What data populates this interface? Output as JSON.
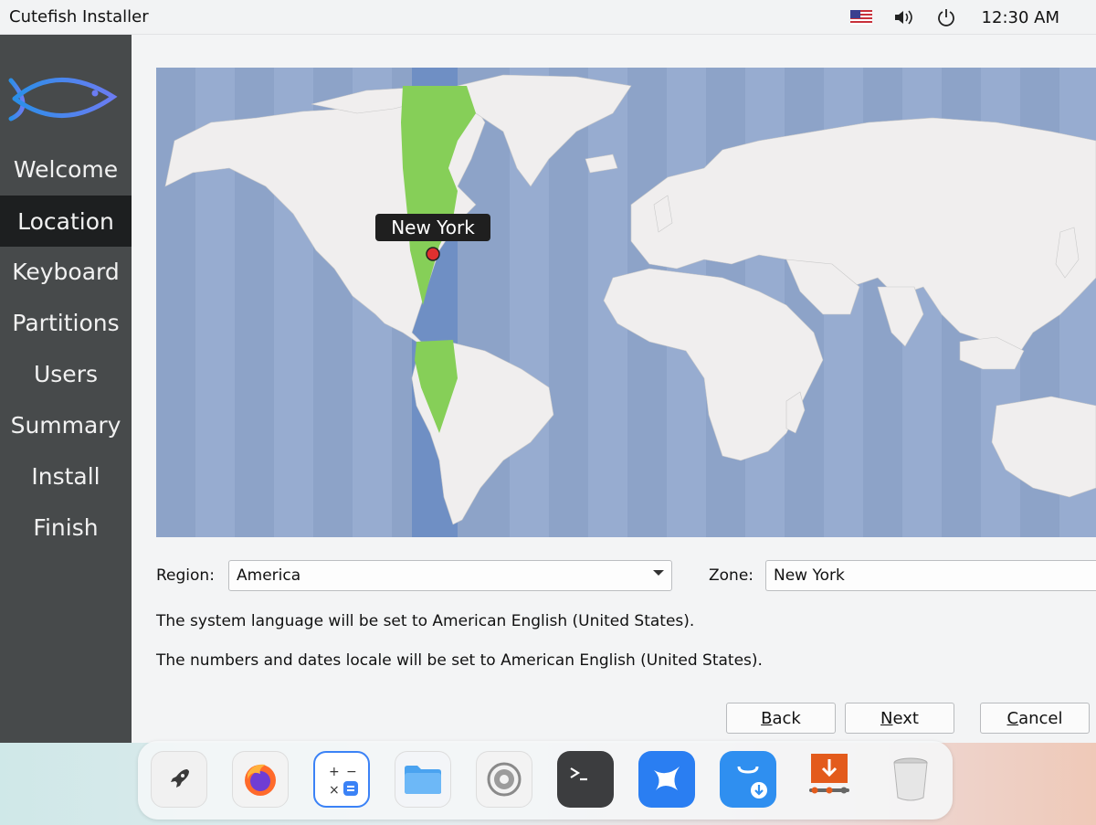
{
  "window": {
    "title": "Cutefish Installer"
  },
  "tray": {
    "time": "12:30 AM",
    "icons": [
      "us-flag-icon",
      "volume-icon",
      "power-icon"
    ]
  },
  "sidebar": {
    "logo": "fish-logo-icon",
    "active_index": 1,
    "items": [
      {
        "label": "Welcome"
      },
      {
        "label": "Location"
      },
      {
        "label": "Keyboard"
      },
      {
        "label": "Partitions"
      },
      {
        "label": "Users"
      },
      {
        "label": "Summary"
      },
      {
        "label": "Install"
      },
      {
        "label": "Finish"
      }
    ]
  },
  "map": {
    "pin_label": "New York"
  },
  "region": {
    "label": "Region:",
    "value": "America"
  },
  "zone": {
    "label": "Zone:",
    "value": "New York"
  },
  "info": {
    "language": "The system language will be set to American English (United States).",
    "locale": "The numbers and dates locale will be set to American English (United States)."
  },
  "buttons": {
    "back": {
      "mnemonic": "B",
      "rest": "ack"
    },
    "next": {
      "mnemonic": "N",
      "rest": "ext"
    },
    "cancel": {
      "mnemonic": "C",
      "rest": "ancel"
    }
  },
  "dock": {
    "apps": [
      "launcher-rocket-icon",
      "firefox-icon",
      "calculator-icon",
      "files-folder-icon",
      "settings-gear-icon",
      "terminal-icon",
      "browser-swift-icon",
      "store-download-icon",
      "installer-download-icon",
      "trash-icon"
    ]
  },
  "colors": {
    "sidebar": "#474a4b",
    "sidebar_active": "#1d1f20",
    "ocean": "#8da3c8",
    "land": "#f0eeee",
    "timezone_highlight": "#86cf58"
  }
}
